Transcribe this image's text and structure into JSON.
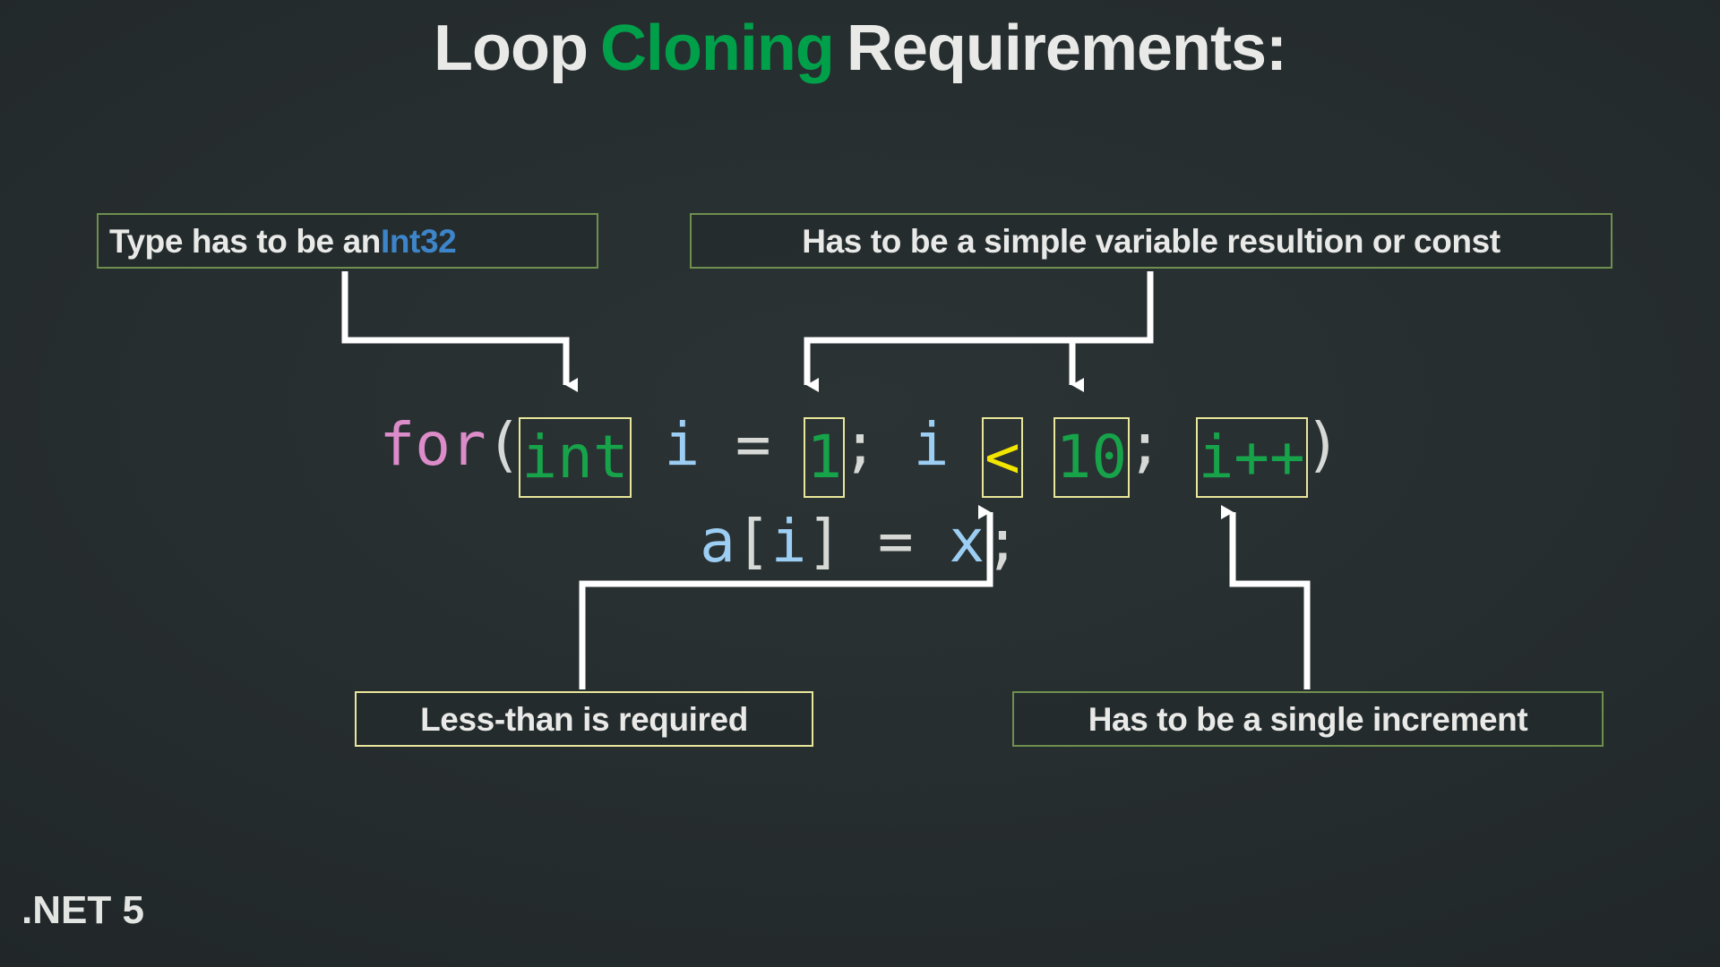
{
  "slide": {
    "background_color": "#22292b",
    "title": {
      "part1": "Loop",
      "part2": "Cloning",
      "part3": "Requirements:",
      "accent_color": "#00a04a",
      "text_color": "#e9eae8"
    },
    "brand": ".NET 5"
  },
  "callouts": [
    {
      "id": "int32",
      "text_before": "Type has to be an ",
      "highlight": "Int32",
      "highlight_color": "#3d85c9",
      "border_color": "#6f8f4f"
    },
    {
      "id": "simple",
      "text": "Has to be a simple variable resultion or const",
      "border_color": "#6f8f4f"
    },
    {
      "id": "less-than",
      "text": "Less-than is required",
      "border_color": "#e9e79a"
    },
    {
      "id": "single-increment",
      "text": "Has to be a single increment",
      "border_color": "#6f8f4f"
    }
  ],
  "code": {
    "line1": {
      "keyword_for": "for",
      "paren_open": "(",
      "type_int": "int",
      "space1": " ",
      "var_i1": "i",
      "equals": " = ",
      "num_1": "1",
      "semi1": "; ",
      "var_i2": "i",
      "space2": " ",
      "op_lt": "<",
      "space3": " ",
      "num_10": "10",
      "semi2": "; ",
      "incr": "i++",
      "paren_close": ")"
    },
    "line2": "a[i] = x;",
    "line2_parts": {
      "a": "a",
      "bracket_open": "[",
      "i": "i",
      "bracket_close": "]",
      "equals": " = ",
      "x": "x",
      "semi": ";"
    },
    "highlight_border_color": "#e9e79a",
    "colors": {
      "keyword": "#dc8cc8",
      "variable": "#9ccdf2",
      "punctuation": "#d6d9d6",
      "number": "#17a34a",
      "type": "#17a34a",
      "operator": "#f2e500"
    }
  },
  "connectors": {
    "color": "#ffffff",
    "items": [
      {
        "from": "callout-int32",
        "to": "code-int"
      },
      {
        "from": "callout-simple",
        "to": "code-num-1"
      },
      {
        "from": "callout-simple",
        "to": "code-num-10"
      },
      {
        "from": "callout-less-than",
        "to": "code-op-lt"
      },
      {
        "from": "callout-single-increment",
        "to": "code-incr"
      }
    ]
  }
}
